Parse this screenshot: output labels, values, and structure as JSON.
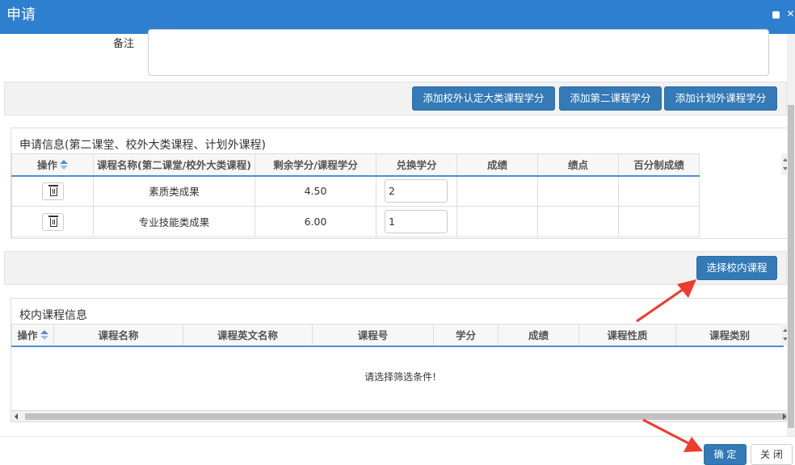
{
  "window": {
    "title": "申请"
  },
  "form": {
    "remark_label": "备注",
    "remark_value": ""
  },
  "toolbar1": {
    "buttons": [
      "添加校外认定大类课程学分",
      "添加第二课程学分",
      "添加计划外课程学分"
    ]
  },
  "apply_panel": {
    "title": "申请信息(第二课堂、校外大类课程、计划外课程)",
    "columns": [
      "操作",
      "课程名称(第二课堂/校外大类课程)",
      "剩余学分/课程学分",
      "兑换学分",
      "成绩",
      "绩点",
      "百分制成绩"
    ],
    "rows": [
      {
        "name": "素质类成果",
        "remaining": "4.50",
        "exchange": "2",
        "score": "",
        "gpa": "",
        "percent": ""
      },
      {
        "name": "专业技能类成果",
        "remaining": "6.00",
        "exchange": "1",
        "score": "",
        "gpa": "",
        "percent": ""
      }
    ]
  },
  "toolbar2": {
    "select_button": "选择校内课程"
  },
  "course_panel": {
    "title": "校内课程信息",
    "columns": [
      "操作",
      "课程名称",
      "课程英文名称",
      "课程号",
      "学分",
      "成绩",
      "课程性质",
      "课程类别"
    ],
    "empty_message": "请选择筛选条件!"
  },
  "footer": {
    "confirm_label": "确 定",
    "close_label": "关 闭"
  },
  "colors": {
    "title_bar": "#2f7fd0",
    "primary_button": "#337ab7",
    "annotation_arrow": "#ee3b2e"
  }
}
